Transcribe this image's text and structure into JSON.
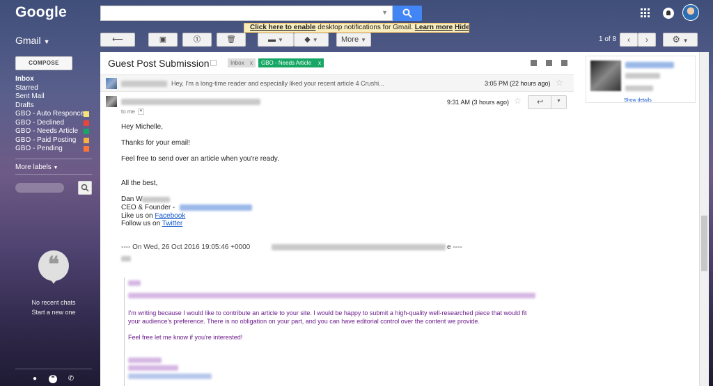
{
  "header": {
    "logo": "Google",
    "search": {
      "value": "",
      "placeholder": ""
    },
    "icons": [
      "apps-icon",
      "notifications-icon",
      "account-avatar"
    ]
  },
  "app": {
    "name": "Gmail"
  },
  "toolbar": {
    "more_label": "More",
    "notify_link": "Click here to enable",
    "notify_text": "desktop notifications for Gmail.",
    "learn_more": "Learn more",
    "hide": "Hide",
    "page_count": "1 of 8"
  },
  "sidebar": {
    "compose": "COMPOSE",
    "items": [
      {
        "label": "Inbox",
        "color": ""
      },
      {
        "label": "Starred",
        "color": ""
      },
      {
        "label": "Sent Mail",
        "color": ""
      },
      {
        "label": "Drafts",
        "color": ""
      },
      {
        "label": "GBO - Auto Responce",
        "color": "#f5e27a"
      },
      {
        "label": "GBO - Declined",
        "color": "#e8453c"
      },
      {
        "label": "GBO - Needs Article",
        "color": "#16a765"
      },
      {
        "label": "GBO - Paid Posting",
        "color": "#f6b046"
      },
      {
        "label": "GBO - Pending",
        "color": "#ff7537"
      }
    ],
    "more_labels": "More labels",
    "no_chats": "No recent chats",
    "start_new": "Start a new one"
  },
  "thread": {
    "subject": "Guest Post Submission",
    "labels": [
      {
        "name": "Inbox",
        "x": "x"
      },
      {
        "name": "GBO - Needs Article",
        "x": "x"
      }
    ],
    "collapsed": {
      "snippet": "Hey, I'm a long-time reader and especially liked your recent article 4 Crushi...",
      "time": "3:05 PM (22 hours ago)"
    },
    "message": {
      "to": "to me",
      "time": "9:31 AM (3 hours ago)",
      "lines": {
        "greeting": "Hey Michelle,",
        "thanks": "Thanks for your email!",
        "feel_free": "Feel free to send over an article when you're ready.",
        "best": "All the best,",
        "name": "Dan W",
        "title": "CEO & Founder - ",
        "like_prefix": "Like us on ",
        "like_link": "Facebook",
        "follow_prefix": "Follow us on ",
        "follow_link": "Twitter",
        "quote_header": "---- On Wed, 26 Oct 2016 19:05:46 +0000",
        "quote_header_end": "e ----"
      }
    },
    "quoted": {
      "line1": "I'm writing because I would like to contribute an article to your site. I would be happy to submit a high-quality well-researched piece that would fit",
      "line2": "your audience's preference. There is no obligation on your part, and you can have editorial control over the content we provide.",
      "line3": "Feel free let me know if you're interested!"
    },
    "contact_card": {
      "show_details": "Show details"
    }
  }
}
